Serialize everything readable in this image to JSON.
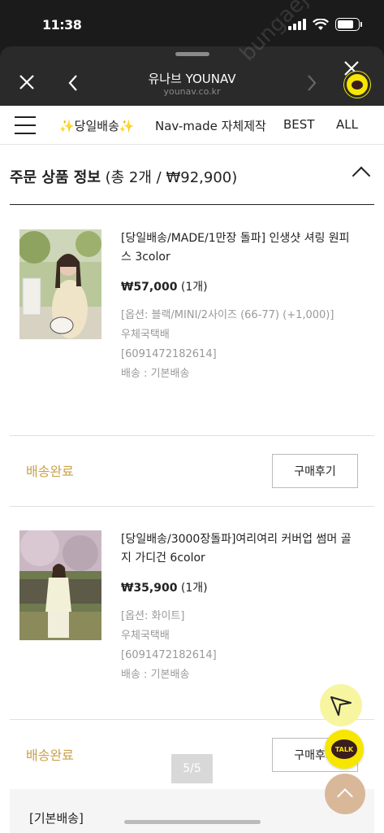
{
  "status_bar": {
    "time": "11:38"
  },
  "browser": {
    "title": "유나브 YOUNAV",
    "url": "younav.co.kr",
    "watermark": "bungaejangter... gonara"
  },
  "category_nav": {
    "items": [
      "✨당일배송✨",
      "Nav-made 자체제작",
      "BEST",
      "ALL"
    ]
  },
  "order": {
    "title_bold": "주문 상품 정보",
    "title_rest": " (총 2개 / ₩92,900)"
  },
  "products": [
    {
      "name": "[당일배송/MADE/1만장 돌파] 인생샷 셔링 원피스 3color",
      "price": "₩57,000",
      "qty": " (1개)",
      "option": "[옵션: 블랙/MINI/2사이즈 (66-77) (+1,000)]",
      "carrier": "우체국택배",
      "tracking": "[6091472182614]",
      "shipping": "배송 : 기본배송",
      "status": "배송완료",
      "review_label": "구매후기"
    },
    {
      "name": "[당일배송/3000장돌파]여리여리 커버업 썸머 골지 가디건 6color",
      "price": "₩35,900",
      "qty": " (1개)",
      "option": "[옵션: 화이트]",
      "carrier": "우체국택배",
      "tracking": "[6091472182614]",
      "shipping": "배송 : 기본배송",
      "status": "배송완료",
      "review_label": "구매후기"
    }
  ],
  "pager": "5/5",
  "footer_label": "[기본배송]",
  "fab": {
    "talk_label": "TALK"
  },
  "colors": {
    "status": "#c9a24a",
    "kakao": "#f7e600"
  }
}
